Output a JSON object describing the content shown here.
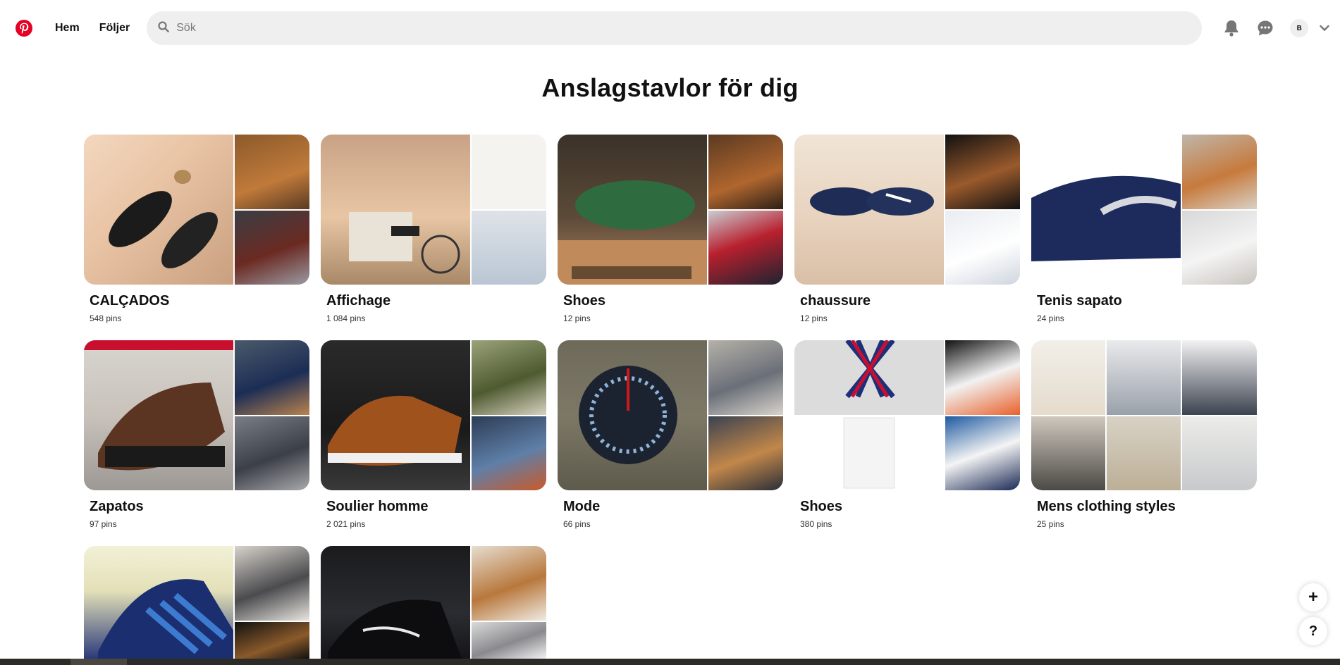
{
  "header": {
    "home_label": "Hem",
    "following_label": "Följer",
    "search_placeholder": "Sök",
    "avatar_initial": "B"
  },
  "page_title": "Anslagstavlor för dig",
  "boards": [
    {
      "name": "CALÇADOS",
      "pins": "548 pins"
    },
    {
      "name": "Affichage",
      "pins": "1 084 pins"
    },
    {
      "name": "Shoes",
      "pins": "12 pins"
    },
    {
      "name": "chaussure",
      "pins": "12 pins"
    },
    {
      "name": "Tenis sapato",
      "pins": "24 pins"
    },
    {
      "name": "Zapatos",
      "pins": "97 pins"
    },
    {
      "name": "Soulier homme",
      "pins": "2 021 pins"
    },
    {
      "name": "Mode",
      "pins": "66 pins"
    },
    {
      "name": "Shoes",
      "pins": "380 pins"
    },
    {
      "name": "Mens clothing styles",
      "pins": "25 pins"
    },
    {
      "name": "",
      "pins": ""
    },
    {
      "name": "",
      "pins": ""
    }
  ],
  "fab": {
    "add": "+",
    "help": "?"
  },
  "colors": {
    "brand": "#e60023",
    "search_bg": "#efefef"
  },
  "icons": [
    "pinterest-logo",
    "search-icon",
    "bell-icon",
    "chat-icon",
    "chevron-down-icon",
    "plus-icon",
    "help-icon"
  ]
}
